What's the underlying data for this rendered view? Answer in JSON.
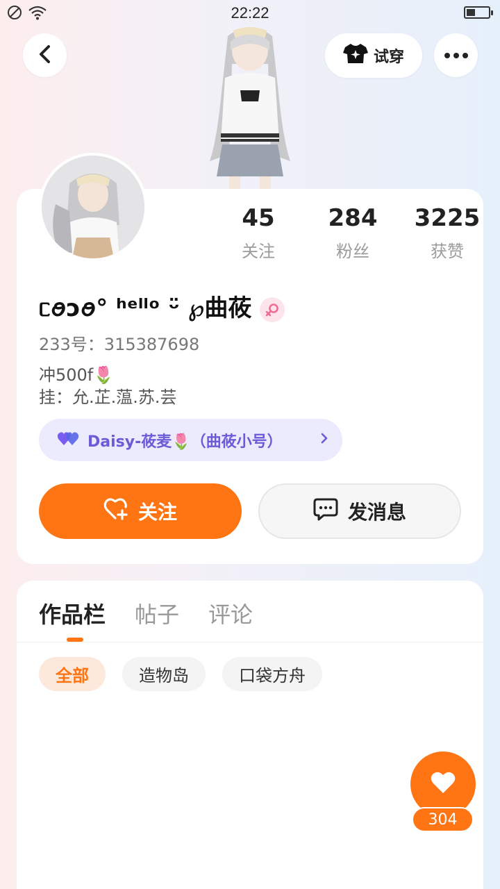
{
  "status_bar": {
    "time": "22:22",
    "battery_level": 0.35,
    "icons": [
      "do-not-disturb-icon",
      "wifi-icon",
      "battery-icon"
    ]
  },
  "header": {
    "back_icon": "chevron-left-icon",
    "try_on_label": "试穿",
    "try_on_icon": "tshirt-sparkle-icon",
    "more_icon": "more-dots-icon"
  },
  "profile": {
    "stats": [
      {
        "value": "45",
        "label": "关注"
      },
      {
        "value": "284",
        "label": "粉丝"
      },
      {
        "value": "3225",
        "label": "获赞"
      }
    ],
    "username": "ᥴꪮᴐꪮ° ʰᵉˡˡᵒ ᵕ̈ ℘曲莜",
    "gender_icon": "female-icon",
    "uid": "233号：315387698",
    "bio_line1": "冲500f🌷",
    "bio_line2": "挂：允.芷.蕰.苏.芸",
    "linked_account": {
      "icon": "double-heart-icon",
      "label": "Daisy-莜麦🌷（曲莜小号）",
      "chevron_icon": "chevron-right-icon"
    },
    "follow_label": "关注",
    "follow_icon": "heart-plus-icon",
    "message_label": "发消息",
    "message_icon": "chat-bubble-icon"
  },
  "works": {
    "tabs": [
      {
        "label": "作品栏",
        "active": true
      },
      {
        "label": "帖子",
        "active": false
      },
      {
        "label": "评论",
        "active": false
      }
    ],
    "chips": [
      {
        "label": "全部",
        "active": true
      },
      {
        "label": "造物岛",
        "active": false
      },
      {
        "label": "口袋方舟",
        "active": false
      }
    ]
  },
  "like_fab": {
    "icon": "heart-icon",
    "count": "304"
  },
  "colors": {
    "accent": "#ff7413",
    "linked_bg": "#eceafd",
    "linked_text": "#6a5bd6"
  }
}
